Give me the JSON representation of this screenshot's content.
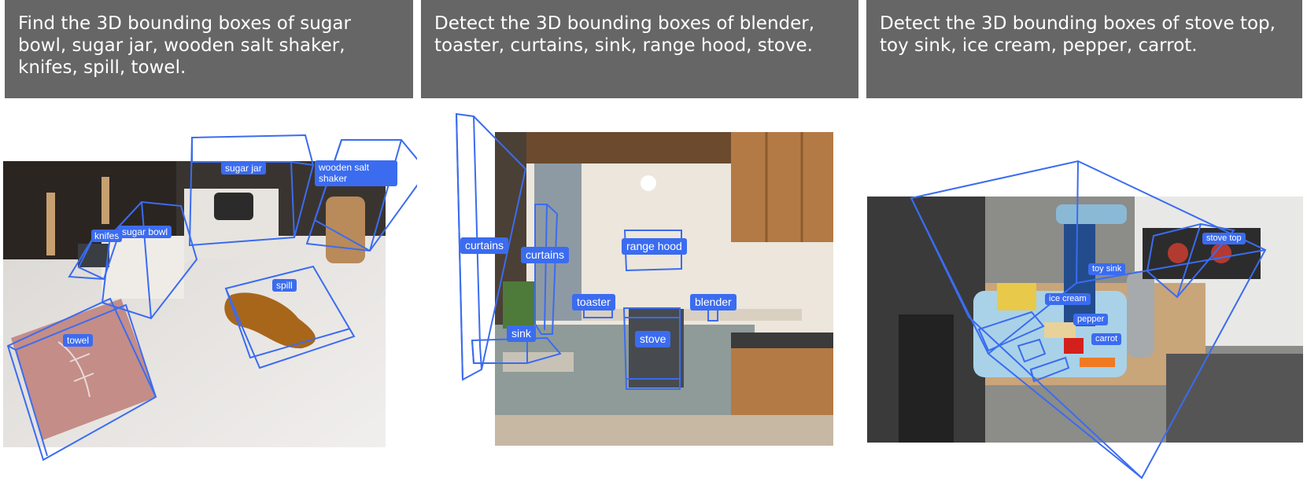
{
  "panels": [
    {
      "prompt": "Find the 3D bounding boxes of sugar bowl, sugar jar, wooden salt shaker, knifes, spill, towel.",
      "labels": [
        "sugar jar",
        "wooden salt shaker",
        "knifes",
        "sugar bowl",
        "spill",
        "towel"
      ]
    },
    {
      "prompt": "Detect the 3D bounding boxes of blender, toaster, curtains, sink, range hood, stove.",
      "labels": [
        "curtains",
        "curtains",
        "range hood",
        "toaster",
        "blender",
        "sink",
        "stove"
      ]
    },
    {
      "prompt": "Detect the 3D bounding boxes of stove top, toy sink, ice cream, pepper, carrot.",
      "labels": [
        "stove top",
        "toy sink",
        "ice cream",
        "pepper",
        "carrot"
      ]
    }
  ],
  "colors": {
    "box": "#3b6cf0",
    "header_bg": "#666666"
  }
}
